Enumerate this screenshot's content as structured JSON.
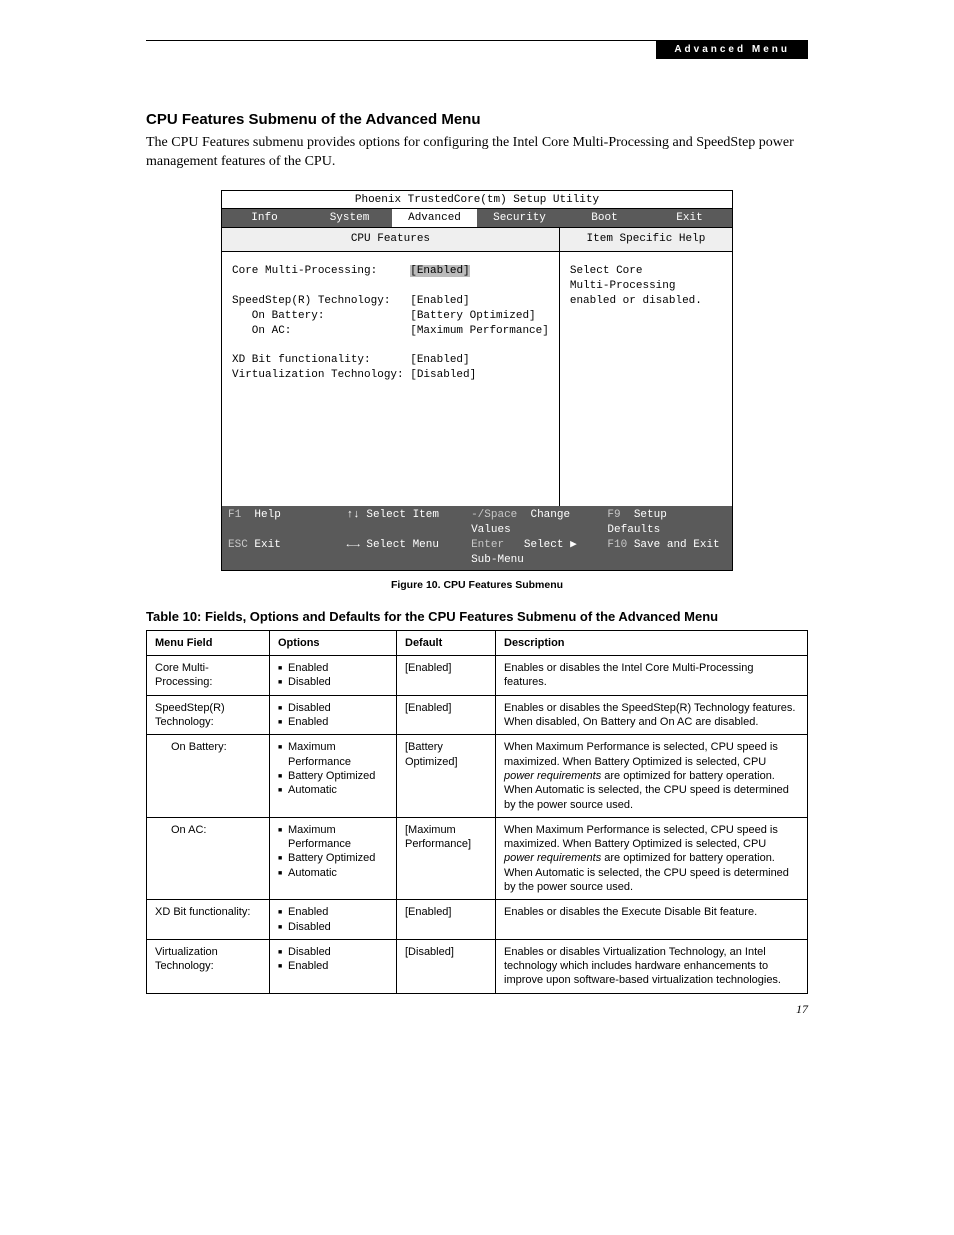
{
  "header_tab": "Advanced Menu",
  "heading": "CPU Features Submenu of the Advanced Menu",
  "intro": "The CPU Features submenu provides options for configuring the Intel Core Multi-Processing and SpeedStep power management features of the CPU.",
  "bios": {
    "title": "Phoenix TrustedCore(tm) Setup Utility",
    "tabs": [
      "Info",
      "System",
      "Advanced",
      "Security",
      "Boot",
      "Exit"
    ],
    "active_tab": "Advanced",
    "left_title": "CPU Features",
    "right_title": "Item Specific Help",
    "settings": [
      {
        "label": "Core Multi-Processing:",
        "value": "[Enabled]",
        "selected": true
      },
      {
        "label": "",
        "value": ""
      },
      {
        "label": "SpeedStep(R) Technology:",
        "value": "[Enabled]"
      },
      {
        "label": "   On Battery:",
        "value": "[Battery Optimized]"
      },
      {
        "label": "   On AC:",
        "value": "[Maximum Performance]"
      },
      {
        "label": "",
        "value": ""
      },
      {
        "label": "XD Bit functionality:",
        "value": "[Enabled]"
      },
      {
        "label": "Virtualization Technology:",
        "value": "[Disabled]"
      }
    ],
    "help_text": "Select Core\nMulti-Processing\nenabled or disabled.",
    "footer": {
      "f1": "F1",
      "f1_label": "Help",
      "select_item": "↑↓ Select Item",
      "minus_space": "-/Space",
      "change_values": "Change Values",
      "f9": "F9",
      "f9_label": "Setup Defaults",
      "esc": "ESC",
      "esc_label": "Exit",
      "select_menu": "←→ Select Menu",
      "enter": "Enter",
      "submenu": "Select ▶ Sub-Menu",
      "f10": "F10",
      "f10_label": "Save and Exit"
    }
  },
  "figure_caption": "Figure 10.  CPU Features Submenu",
  "table_caption": "Table 10: Fields, Options and Defaults for the CPU Features Submenu of the Advanced Menu",
  "table": {
    "headers": [
      "Menu Field",
      "Options",
      "Default",
      "Description"
    ],
    "rows": [
      {
        "field": "Core Multi-Processing:",
        "indent": false,
        "options": [
          "Enabled",
          "Disabled"
        ],
        "default": "[Enabled]",
        "desc": "Enables or disables the Intel Core Multi-Processing features."
      },
      {
        "field": "SpeedStep(R) Technology:",
        "indent": false,
        "options": [
          "Disabled",
          "Enabled"
        ],
        "default": "[Enabled]",
        "desc": "Enables or disables the SpeedStep(R) Technology features. When disabled, On Battery and On AC are disabled."
      },
      {
        "field": "On Battery:",
        "indent": true,
        "options": [
          "Maximum Performance",
          "Battery Optimized",
          "Automatic"
        ],
        "default": "[Battery Optimized]",
        "desc_html": "When Maximum Performance is selected, CPU speed is maximized. When Battery Optimized is selected, CPU <span class=\"italic\">power requirements</span> are optimized for battery operation. When Automatic is selected, the CPU speed is determined by the power source used."
      },
      {
        "field": "On AC:",
        "indent": true,
        "options": [
          "Maximum Performance",
          "Battery Optimized",
          "Automatic"
        ],
        "default": "[Maximum Performance]",
        "desc_html": "When Maximum Performance is selected, CPU speed is maximized. When Battery Optimized is selected, CPU <span class=\"italic\">power requirements</span> are optimized for battery operation. When Automatic is selected, the CPU speed is determined by the power source used."
      },
      {
        "field": "XD Bit functionality:",
        "indent": false,
        "options": [
          "Enabled",
          "Disabled"
        ],
        "default": "[Enabled]",
        "desc": "Enables or disables the Execute Disable Bit feature."
      },
      {
        "field": "Virtualization Technology:",
        "indent": false,
        "options": [
          "Disabled",
          "Enabled"
        ],
        "default": "[Disabled]",
        "desc": "Enables or disables Virtualization Technology, an Intel technology which includes hardware enhancements to improve upon software-based virtualization technologies."
      }
    ]
  },
  "page_number": "17"
}
